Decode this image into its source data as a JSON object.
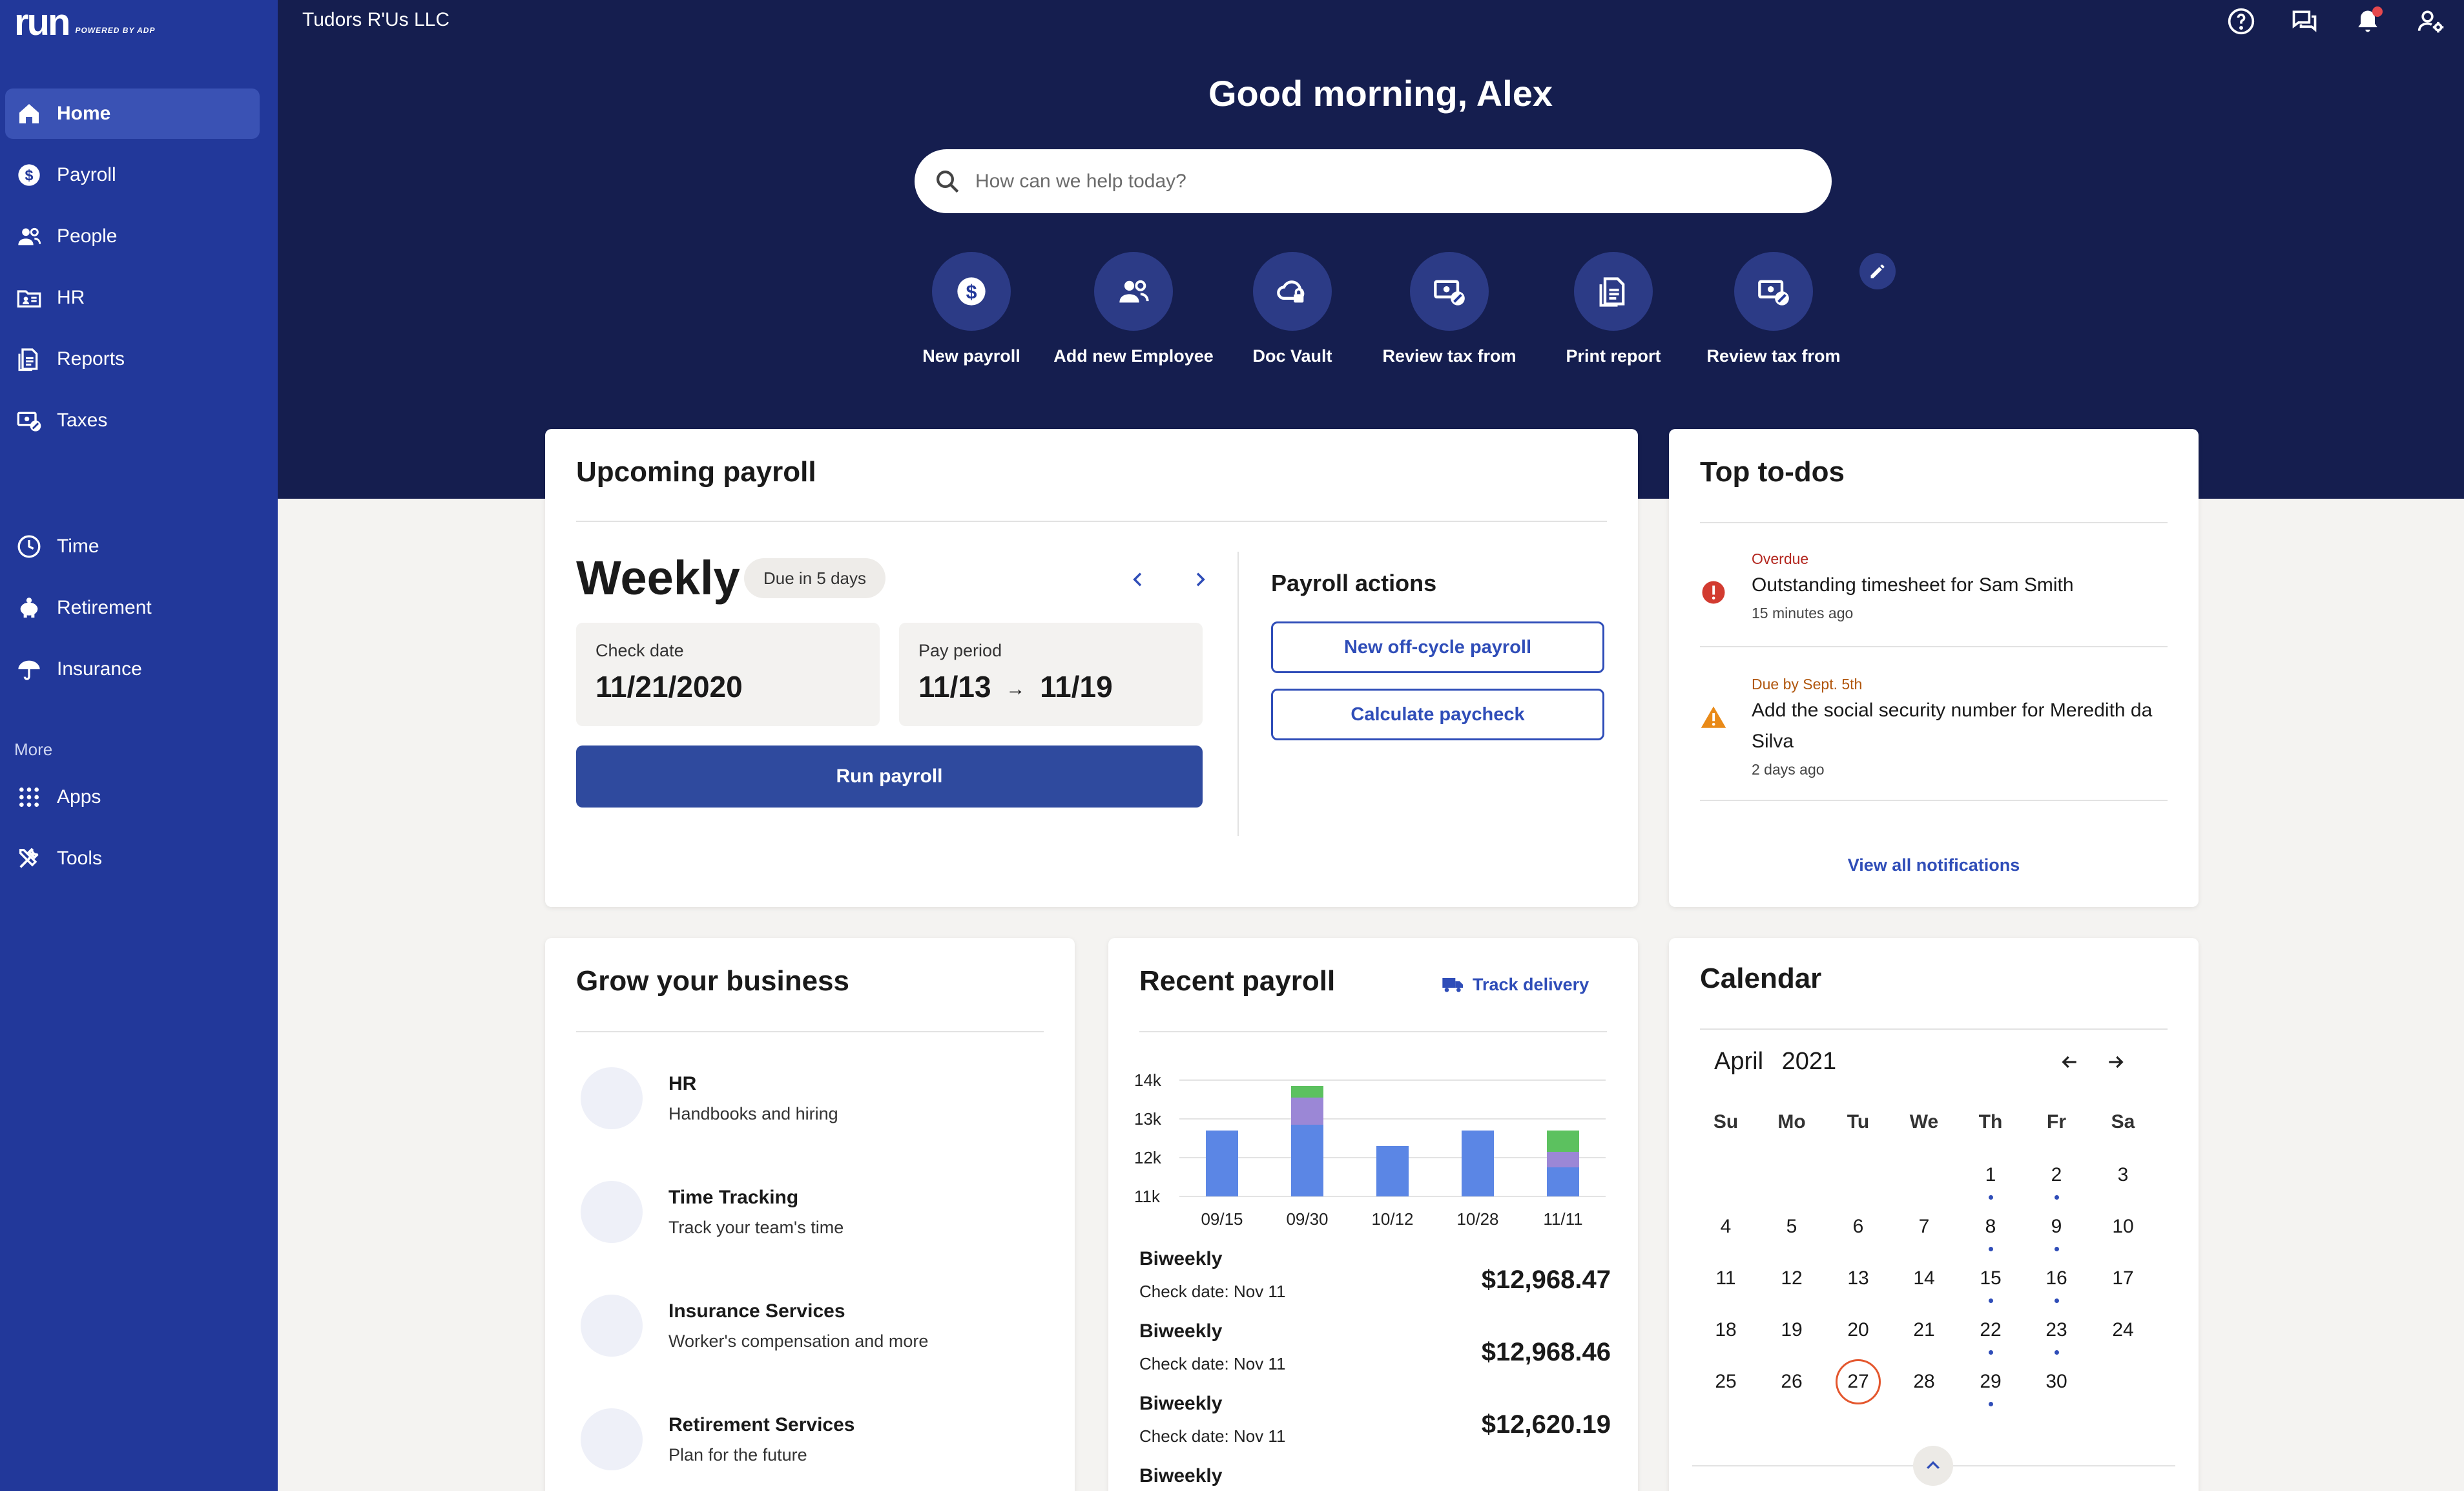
{
  "app": {
    "logo_text": "run",
    "logo_sub": "POWERED BY ADP",
    "company": "Tudors R'Us LLC"
  },
  "sidebar": {
    "items": [
      {
        "label": "Home",
        "icon": "home-icon",
        "active": true
      },
      {
        "label": "Payroll",
        "icon": "dollar-icon"
      },
      {
        "label": "People",
        "icon": "people-icon"
      },
      {
        "label": "HR",
        "icon": "id-folder-icon"
      },
      {
        "label": "Reports",
        "icon": "report-icon"
      },
      {
        "label": "Taxes",
        "icon": "tax-icon"
      },
      {
        "label": "Time",
        "icon": "clock-icon"
      },
      {
        "label": "Retirement",
        "icon": "piggy-bank-icon"
      },
      {
        "label": "Insurance",
        "icon": "umbrella-icon"
      }
    ],
    "more_label": "More",
    "more_items": [
      {
        "label": "Apps",
        "icon": "apps-grid-icon"
      },
      {
        "label": "Tools",
        "icon": "tools-icon"
      }
    ]
  },
  "header": {
    "greeting": "Good morning, Alex",
    "search_placeholder": "How can we help today?",
    "top_icons": [
      "help-icon",
      "chat-icon",
      "bell-icon",
      "user-settings-icon"
    ],
    "quick_actions": [
      {
        "label": "New payroll",
        "icon": "dollar-icon"
      },
      {
        "label": "Add new Employee",
        "icon": "people-icon"
      },
      {
        "label": "Doc Vault",
        "icon": "cloud-lock-icon"
      },
      {
        "label": "Review tax from",
        "icon": "tax-icon"
      },
      {
        "label": "Print report",
        "icon": "report-icon"
      },
      {
        "label": "Review tax from",
        "icon": "tax-icon"
      }
    ]
  },
  "upcoming_payroll": {
    "title": "Upcoming payroll",
    "frequency": "Weekly",
    "due_badge": "Due in 5 days",
    "check_date_label": "Check date",
    "check_date": "11/21/2020",
    "pay_period_label": "Pay period",
    "pay_period_start": "11/13",
    "pay_period_arrow": "→",
    "pay_period_end": "11/19",
    "run_button": "Run payroll",
    "actions_title": "Payroll actions",
    "action_offcycle": "New off-cycle payroll",
    "action_calc": "Calculate paycheck"
  },
  "todos": {
    "title": "Top to-dos",
    "items": [
      {
        "status": "Overdue",
        "text": "Outstanding timesheet for Sam Smith",
        "time": "15 minutes ago",
        "severity": "error"
      },
      {
        "status": "Due by Sept. 5th",
        "text": "Add the social security number for Meredith da Silva",
        "time": "2 days ago",
        "severity": "warning"
      }
    ],
    "view_all": "View all notifications"
  },
  "grow": {
    "title": "Grow your business",
    "items": [
      {
        "title": "HR",
        "desc": "Handbooks and hiring",
        "icon": "id-folder-icon"
      },
      {
        "title": "Time Tracking",
        "desc": "Track your team's time",
        "icon": "stopwatch-icon"
      },
      {
        "title": "Insurance Services",
        "desc": "Worker's compensation and more",
        "icon": "umbrella-icon"
      },
      {
        "title": "Retirement Services",
        "desc": "Plan for the future",
        "icon": "piggy-bank-icon"
      }
    ]
  },
  "recent_payroll": {
    "title": "Recent payroll",
    "track_label": "Track delivery",
    "rows": [
      {
        "name": "Biweekly",
        "date": "Check date: Nov 11",
        "amount": "$12,968.47"
      },
      {
        "name": "Biweekly",
        "date": "Check date: Nov 11",
        "amount": "$12,968.46"
      },
      {
        "name": "Biweekly",
        "date": "Check date: Nov 11",
        "amount": "$12,620.19"
      },
      {
        "name": "Biweekly",
        "date": "",
        "amount": ""
      }
    ]
  },
  "chart_data": {
    "type": "bar",
    "stacked": true,
    "categories": [
      "09/15",
      "09/30",
      "10/12",
      "10/28",
      "11/11"
    ],
    "yticks": [
      "14k",
      "13k",
      "12k",
      "11k"
    ],
    "ylim": [
      11000,
      14000
    ],
    "series": [
      {
        "color": "#5b86e5",
        "values": [
          12700,
          12850,
          12300,
          12700,
          11750
        ]
      },
      {
        "color": "#9b87d6",
        "values": [
          0,
          700,
          0,
          0,
          400
        ]
      },
      {
        "color": "#5cc15f",
        "values": [
          0,
          300,
          0,
          0,
          550
        ]
      }
    ],
    "grid": true
  },
  "calendar": {
    "title": "Calendar",
    "month": "April",
    "year": "2021",
    "weekdays": [
      "Su",
      "Mo",
      "Tu",
      "We",
      "Th",
      "Fr",
      "Sa"
    ],
    "first_weekday_index": 4,
    "days_in_month": 30,
    "today": 27,
    "dotted_days": [
      1,
      2,
      8,
      9,
      15,
      16,
      22,
      23,
      29
    ]
  }
}
